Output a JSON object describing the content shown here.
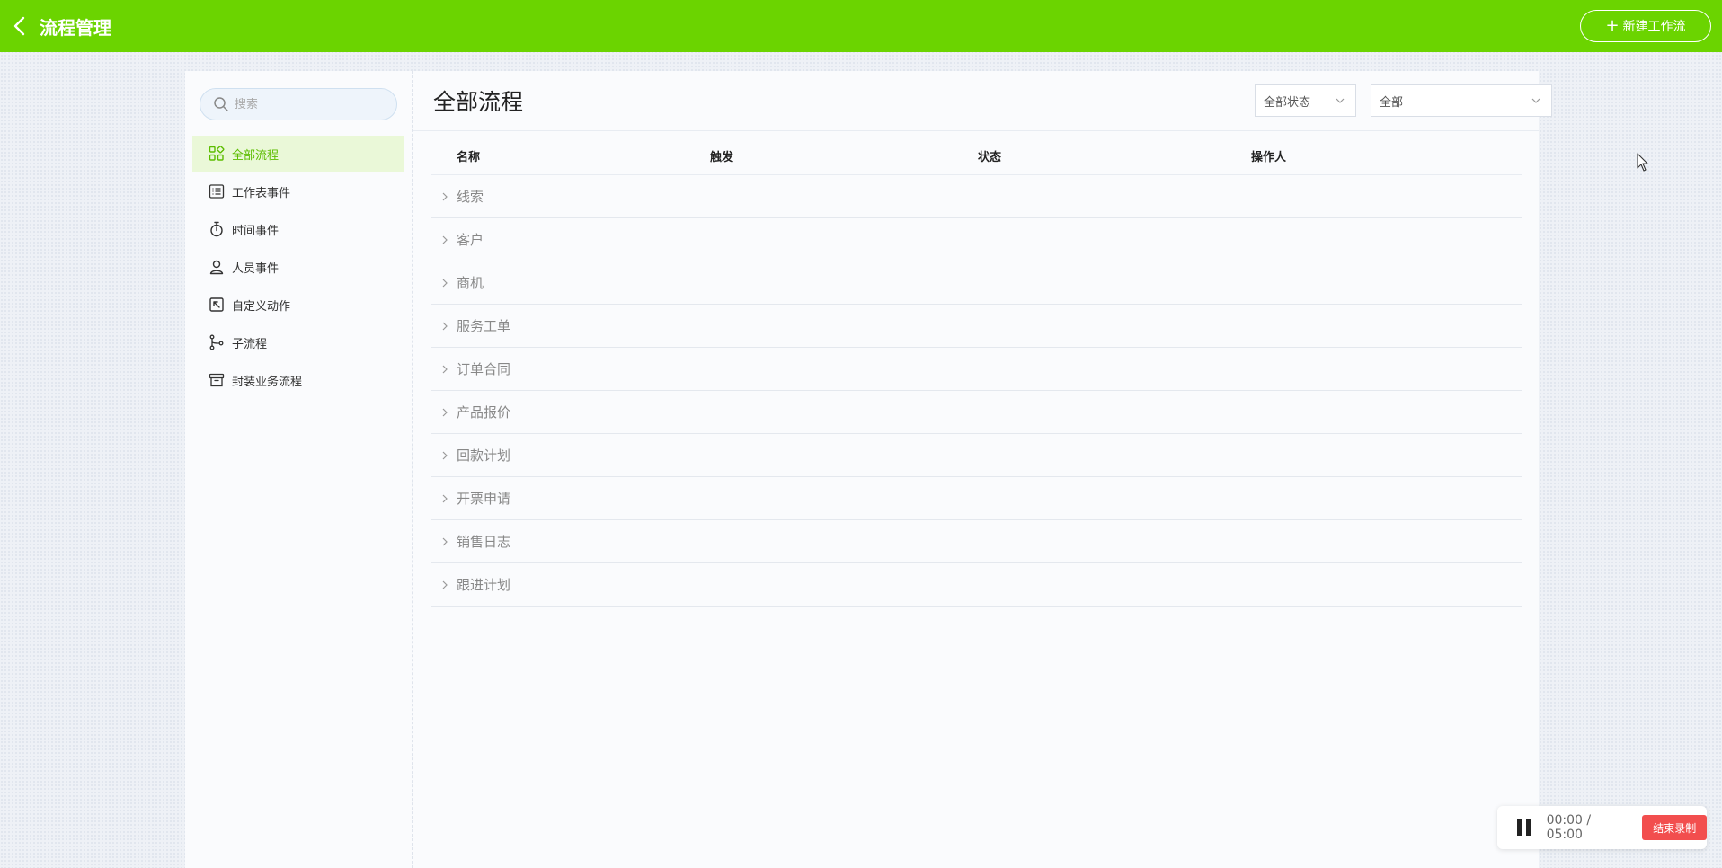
{
  "header": {
    "title": "流程管理",
    "new_button_label": "新建工作流",
    "accent_color": "#6bd400"
  },
  "sidebar": {
    "search_placeholder": "搜索",
    "items": [
      {
        "label": "全部流程",
        "icon": "grid-icon",
        "active": true
      },
      {
        "label": "工作表事件",
        "icon": "list-icon",
        "active": false
      },
      {
        "label": "时间事件",
        "icon": "stopwatch-icon",
        "active": false
      },
      {
        "label": "人员事件",
        "icon": "person-icon",
        "active": false
      },
      {
        "label": "自定义动作",
        "icon": "custom-action-icon",
        "active": false
      },
      {
        "label": "子流程",
        "icon": "branch-icon",
        "active": false
      },
      {
        "label": "封装业务流程",
        "icon": "archive-icon",
        "active": false
      }
    ]
  },
  "main": {
    "title": "全部流程",
    "filter_status": "全部状态",
    "filter_all": "全部",
    "columns": [
      "名称",
      "触发",
      "状态",
      "操作人"
    ],
    "groups": [
      "线索",
      "客户",
      "商机",
      "服务工单",
      "订单合同",
      "产品报价",
      "回款计划",
      "开票申请",
      "销售日志",
      "跟进计划"
    ]
  },
  "recorder": {
    "time": "00:00 / 05:00",
    "end_label": "结束录制",
    "end_color": "#f24e4e"
  }
}
